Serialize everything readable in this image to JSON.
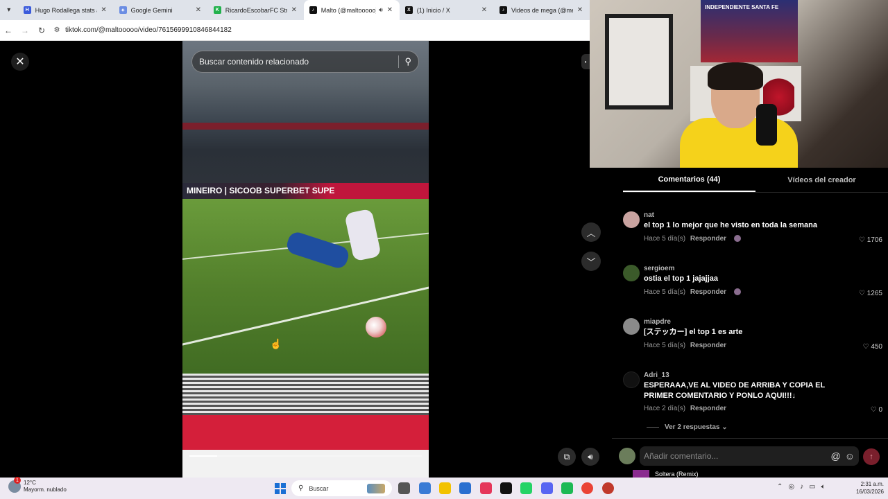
{
  "browser": {
    "tabs": [
      {
        "label": "Hugo Rodallega stats and",
        "favicon_color": "#3b5bdb",
        "active": false
      },
      {
        "label": "Google Gemini",
        "favicon_color": "#6b8de3",
        "active": false
      },
      {
        "label": "RicardoEscobarFC Stream",
        "favicon_color": "#22b14c",
        "active": false
      },
      {
        "label": "Malto (@maltooooo)",
        "favicon_color": "#111111",
        "active": true
      },
      {
        "label": "(1) Inicio / X",
        "favicon_color": "#111111",
        "active": false
      },
      {
        "label": "Videos de mega (@mega",
        "favicon_color": "#111111",
        "active": false
      }
    ],
    "url": "tiktok.com/@maltooooo/video/7615699910846844182"
  },
  "video": {
    "search_placeholder": "Buscar contenido relacionado",
    "board_text": "MINEIRO | SICOOB   SUPERBET   SUPE",
    "progress": 0.12
  },
  "webcam": {
    "banner_text": "INDEPENDIENTE SANTA FE"
  },
  "panel": {
    "tabs": [
      {
        "label": "Comentarios (44)",
        "active": true
      },
      {
        "label": "Vídeos del creador",
        "active": false
      }
    ],
    "comments": [
      {
        "user": "nat",
        "text": "el top 1 lo mejor que he visto en toda la semana",
        "time": "Hace 5 día(s)",
        "reply": "Responder",
        "likes": "1706",
        "avatar_color": "#c9a3a0",
        "creator_liked": true
      },
      {
        "user": "sergioem",
        "text": "ostia el top 1 jajajjaa",
        "time": "Hace 5 día(s)",
        "reply": "Responder",
        "likes": "1265",
        "avatar_color": "#3b5a2a",
        "creator_liked": true
      },
      {
        "user": "miapdre",
        "text": "[ステッカー] el top 1 es arte",
        "time": "Hace 5 día(s)",
        "reply": "Responder",
        "likes": "450",
        "avatar_color": "#8a8a8a",
        "creator_liked": false
      },
      {
        "user": "Adri_13",
        "text": "ESPERAAA,VE AL VIDEO DE ARRIBA Y COPIA EL PRIMER COMENTARIO Y PONLO AQUI!!!↓",
        "time": "Hace 2 día(s)",
        "reply": "Responder",
        "likes": "0",
        "avatar_color": "#111111",
        "creator_liked": false
      }
    ],
    "more_replies": "Ver 2 respuestas",
    "comment_placeholder": "Añadir comentario...",
    "now_playing": "Soltera (Remix)"
  },
  "taskbar": {
    "temperature": "12°C",
    "weather": "Mayorm. nublado",
    "search_label": "Buscar",
    "time": "2:31 a.m.",
    "date": "16/03/2026",
    "app_colors": [
      "#555555",
      "#3a7bd5",
      "#f2c200",
      "#2a6fd0",
      "#e5365a",
      "#111111",
      "#25d366",
      "#5865f2",
      "#1db954",
      "#ea4335",
      "#c0392b"
    ]
  }
}
